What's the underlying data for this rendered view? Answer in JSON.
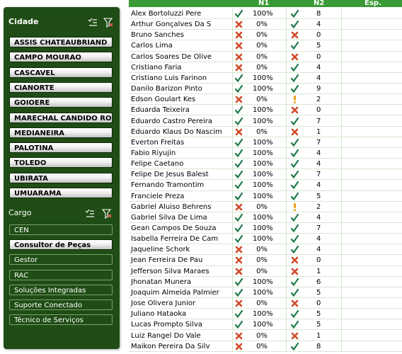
{
  "colors": {
    "panel": "#1f4d15",
    "header": "#3a9a35",
    "check": "#1f7a4a",
    "cross": "#d04a2a",
    "warn": "#e8a317"
  },
  "cidade": {
    "title": "Cidade",
    "items": [
      "ASSIS CHATEAUBRIAND",
      "CAMPO MOURAO",
      "CASCAVEL",
      "CIANORTE",
      "GOIOERE",
      "MARECHAL CANDIDO RON...",
      "MEDIANEIRA",
      "PALOTINA",
      "TOLEDO",
      "UBIRATA",
      "UMUARAMA"
    ]
  },
  "cargo": {
    "title": "Cargo",
    "items": [
      {
        "label": "CEN",
        "selected": false
      },
      {
        "label": "Consultor de Peças",
        "selected": true
      },
      {
        "label": "Gestor",
        "selected": false
      },
      {
        "label": "RAC",
        "selected": false
      },
      {
        "label": "Soluções Integradas",
        "selected": false
      },
      {
        "label": "Suporte Conectado",
        "selected": false
      },
      {
        "label": "Técnico de Serviços",
        "selected": false
      }
    ]
  },
  "table": {
    "headers": {
      "n1": "N1",
      "n2": "N2",
      "esp": "Esp."
    },
    "rows": [
      {
        "name": "Alex Bortoluzzi Pere",
        "n1_icon": "check",
        "n1": "100%",
        "n2_icon": "check",
        "n2": "8"
      },
      {
        "name": "Arthur Gonçalves Da S",
        "n1_icon": "cross",
        "n1": "0%",
        "n2_icon": "check",
        "n2": "4"
      },
      {
        "name": "Bruno Sanches",
        "n1_icon": "cross",
        "n1": "0%",
        "n2_icon": "cross",
        "n2": "0"
      },
      {
        "name": "Carlos Lima",
        "n1_icon": "cross",
        "n1": "0%",
        "n2_icon": "check",
        "n2": "5"
      },
      {
        "name": "Carlos Soares De Olive",
        "n1_icon": "cross",
        "n1": "0%",
        "n2_icon": "cross",
        "n2": "0"
      },
      {
        "name": "Cristiano Faria",
        "n1_icon": "cross",
        "n1": "0%",
        "n2_icon": "check",
        "n2": "4"
      },
      {
        "name": "Cristiano Luis Farinon",
        "n1_icon": "check",
        "n1": "100%",
        "n2_icon": "check",
        "n2": "4"
      },
      {
        "name": "Danilo Barizon Pinto",
        "n1_icon": "check",
        "n1": "100%",
        "n2_icon": "check",
        "n2": "9"
      },
      {
        "name": "Edson Goulart Kes",
        "n1_icon": "cross",
        "n1": "0%",
        "n2_icon": "warn",
        "n2": "2"
      },
      {
        "name": "Eduarda Teixeira",
        "n1_icon": "check",
        "n1": "100%",
        "n2_icon": "cross",
        "n2": "0"
      },
      {
        "name": "Eduardo Castro Pereira",
        "n1_icon": "check",
        "n1": "100%",
        "n2_icon": "check",
        "n2": "7"
      },
      {
        "name": "Eduardo Klaus Do Nascim",
        "n1_icon": "cross",
        "n1": "0%",
        "n2_icon": "cross",
        "n2": "1"
      },
      {
        "name": "Everton Freitas",
        "n1_icon": "check",
        "n1": "100%",
        "n2_icon": "check",
        "n2": "7"
      },
      {
        "name": "Fabio Riyujin",
        "n1_icon": "check",
        "n1": "100%",
        "n2_icon": "check",
        "n2": "4"
      },
      {
        "name": "Felipe Caetano",
        "n1_icon": "check",
        "n1": "100%",
        "n2_icon": "check",
        "n2": "4"
      },
      {
        "name": "Felipe De Jesus Balest",
        "n1_icon": "check",
        "n1": "100%",
        "n2_icon": "check",
        "n2": "7"
      },
      {
        "name": "Fernando Tramontim",
        "n1_icon": "check",
        "n1": "100%",
        "n2_icon": "check",
        "n2": "4"
      },
      {
        "name": "Franciele Preza",
        "n1_icon": "check",
        "n1": "100%",
        "n2_icon": "check",
        "n2": "5"
      },
      {
        "name": "Gabriel Aluiso Behrens",
        "n1_icon": "cross",
        "n1": "0%",
        "n2_icon": "warn",
        "n2": "2"
      },
      {
        "name": "Gabriel Silva De Lima",
        "n1_icon": "check",
        "n1": "100%",
        "n2_icon": "check",
        "n2": "4"
      },
      {
        "name": "Gean Campos De Souza",
        "n1_icon": "check",
        "n1": "100%",
        "n2_icon": "check",
        "n2": "7"
      },
      {
        "name": "Isabella Ferreira De Cam",
        "n1_icon": "check",
        "n1": "100%",
        "n2_icon": "check",
        "n2": "4"
      },
      {
        "name": "Jaqueline Schork",
        "n1_icon": "cross",
        "n1": "0%",
        "n2_icon": "check",
        "n2": "4"
      },
      {
        "name": "Jean Ferreira De Pau",
        "n1_icon": "cross",
        "n1": "0%",
        "n2_icon": "cross",
        "n2": "0"
      },
      {
        "name": "Jefferson Silva Maraes",
        "n1_icon": "cross",
        "n1": "0%",
        "n2_icon": "cross",
        "n2": "1"
      },
      {
        "name": "Jhonatan Munera",
        "n1_icon": "check",
        "n1": "100%",
        "n2_icon": "check",
        "n2": "6"
      },
      {
        "name": "Joaquim Almeida Palmier",
        "n1_icon": "check",
        "n1": "100%",
        "n2_icon": "check",
        "n2": "5"
      },
      {
        "name": "Jose Olivera Junior",
        "n1_icon": "cross",
        "n1": "0%",
        "n2_icon": "cross",
        "n2": "0"
      },
      {
        "name": "Juliano Hataoka",
        "n1_icon": "check",
        "n1": "100%",
        "n2_icon": "check",
        "n2": "5"
      },
      {
        "name": "Lucas Prompto Silva",
        "n1_icon": "check",
        "n1": "100%",
        "n2_icon": "check",
        "n2": "5"
      },
      {
        "name": "Luiz Rangel Do Vale",
        "n1_icon": "cross",
        "n1": "0%",
        "n2_icon": "cross",
        "n2": "1"
      },
      {
        "name": "Maikon Pereira Da Silv",
        "n1_icon": "cross",
        "n1": "0%",
        "n2_icon": "check",
        "n2": "8"
      }
    ]
  }
}
